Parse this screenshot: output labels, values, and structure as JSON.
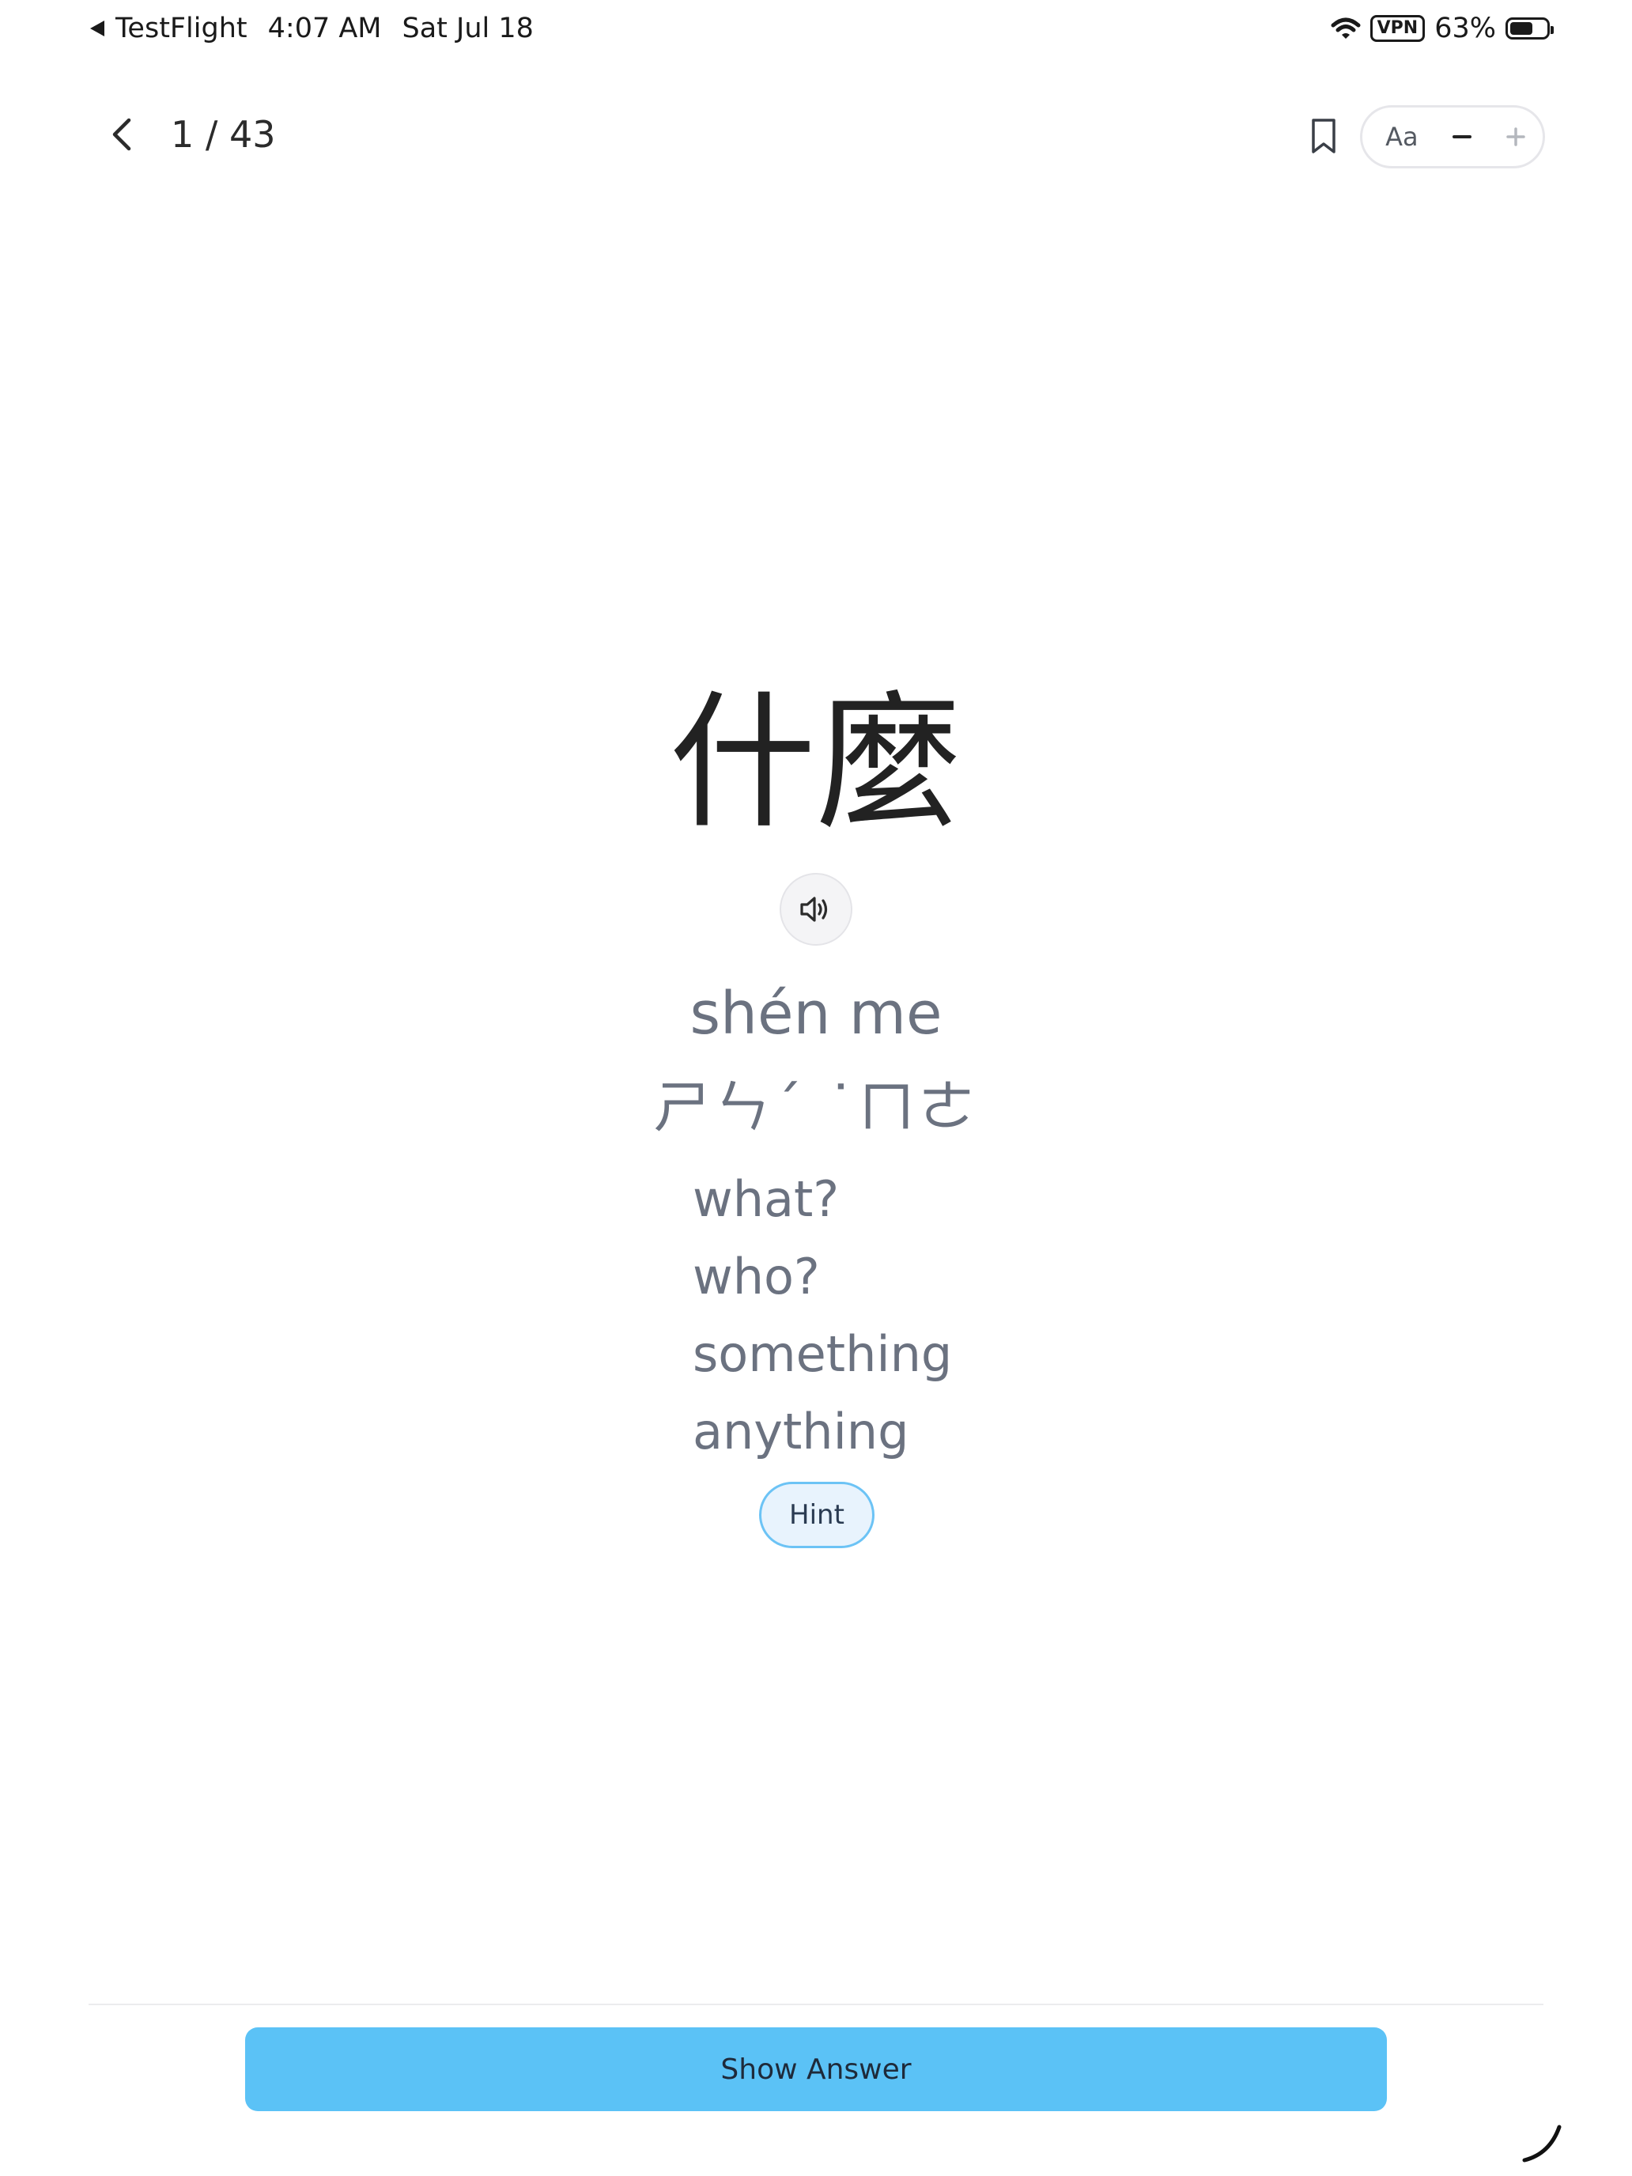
{
  "status_bar": {
    "back_app": "TestFlight",
    "time": "4:07 AM",
    "date": "Sat Jul 18",
    "vpn": "VPN",
    "battery_percent": "63%",
    "battery_level": 0.63
  },
  "header": {
    "progress": "1 / 43",
    "font_label": "Aa",
    "font_decrease": "−",
    "font_increase": "+"
  },
  "card": {
    "hanzi": "什麼",
    "pinyin": "shén me",
    "zhuyin": "ㄕㄣˊ ˙ㄇㄜ",
    "definitions": [
      "what?",
      "who?",
      "something",
      "anything"
    ],
    "hint_label": "Hint"
  },
  "footer": {
    "show_answer_label": "Show Answer"
  },
  "colors": {
    "accent": "#5bc2f6",
    "hint_border": "#6cc3f5",
    "muted_text": "#6b7280"
  },
  "icons": {
    "back": "chevron-left-icon",
    "bookmark": "bookmark-icon",
    "audio": "speaker-icon",
    "wifi": "wifi-icon",
    "battery": "battery-icon"
  }
}
